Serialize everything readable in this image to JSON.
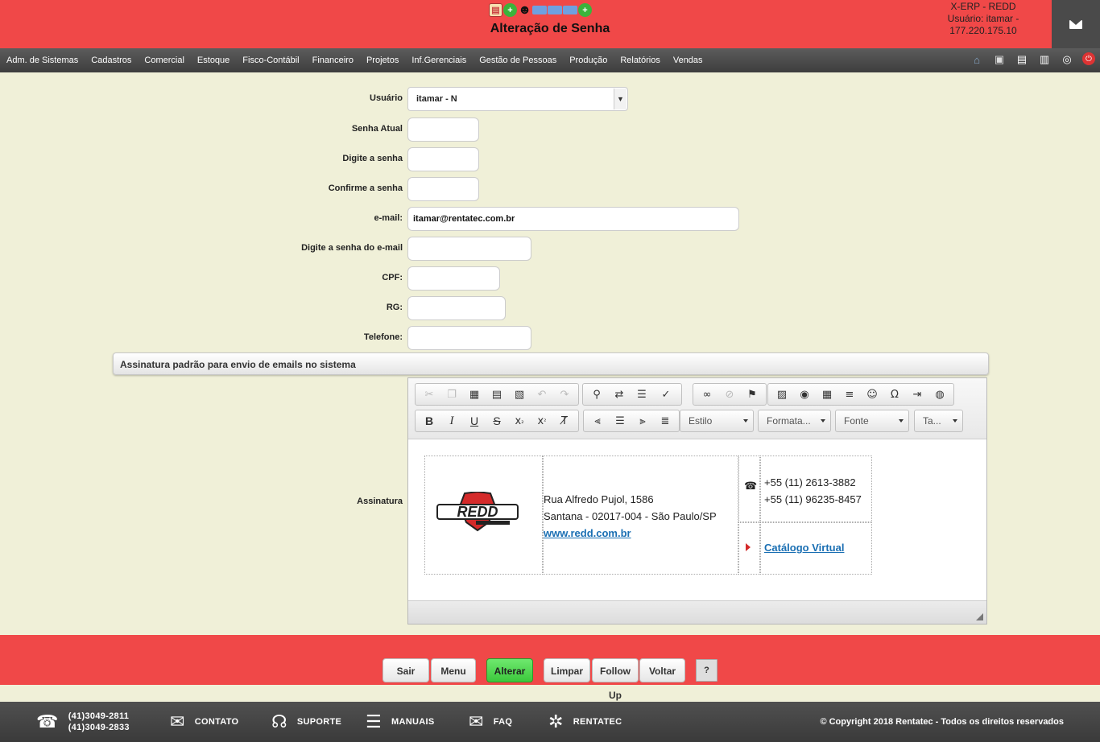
{
  "header": {
    "title": "Alteração de Senha",
    "system_line": "X-ERP - REDD",
    "user_line": "Usuário: itamar -",
    "ip_line": "177.220.175.10",
    "top_icons": [
      "document-icon",
      "add-icon",
      "users-icon",
      "keyboard-icon",
      "keyboard-icon",
      "keyboard-icon",
      "add-icon"
    ],
    "mail_icon": "envelope-icon"
  },
  "menu": {
    "items": [
      "Adm. de Sistemas",
      "Cadastros",
      "Comercial",
      "Estoque",
      "Fisco-Contábil",
      "Financeiro",
      "Projetos",
      "Inf.Gerenciais",
      "Gestão de Pessoas",
      "Produção",
      "Relatórios",
      "Vendas"
    ],
    "right_icons": [
      "home-icon",
      "print-icon",
      "document-icon",
      "page-icon",
      "help-icon",
      "power-icon"
    ]
  },
  "form": {
    "usuario": {
      "label": "Usuário",
      "value": "itamar - N"
    },
    "senha_atual": {
      "label": "Senha Atual",
      "value": ""
    },
    "digite_senha": {
      "label": "Digite a senha",
      "value": ""
    },
    "confirme_senha": {
      "label": "Confirme a senha",
      "value": ""
    },
    "email": {
      "label": "e-mail:",
      "value": "itamar@rentatec.com.br"
    },
    "senha_email": {
      "label": "Digite a senha do e-mail",
      "value": ""
    },
    "cpf": {
      "label": "CPF:",
      "value": ""
    },
    "rg": {
      "label": "RG:",
      "value": ""
    },
    "telefone": {
      "label": "Telefone:",
      "value": ""
    }
  },
  "signature_section": {
    "title": "Assinatura padrão para envio de emails no sistema",
    "label": "Assinatura"
  },
  "editor": {
    "dropdowns": {
      "style": "Estilo",
      "format": "Formata...",
      "font": "Fonte",
      "size": "Ta..."
    }
  },
  "signature": {
    "address1": "Rua Alfredo Pujol, 1586",
    "address2": "Santana - 02017-004 - São Paulo/SP",
    "website": "www.redd.com.br",
    "phone1": "+55 (11) 2613-3882",
    "phone2": "+55 (11) 96235-8457",
    "catalog": "Catálogo Virtual",
    "logo_text": "REDD"
  },
  "buttons": {
    "sair": "Sair",
    "menu": "Menu",
    "alterar": "Alterar",
    "limpar": "Limpar",
    "follow_up": "Follow Up",
    "voltar": "Voltar",
    "help": "?"
  },
  "footer": {
    "phone1": "(41)3049-2811",
    "phone2": "(41)3049-2833",
    "contato": "CONTATO",
    "suporte": "SUPORTE",
    "manuais": "MANUAIS",
    "faq": "FAQ",
    "rentatec": "RENTATEC",
    "copyright": "© Copyright 2018 Rentatec - Todos os direitos reservados"
  },
  "colors": {
    "header_red": "#f04848",
    "menu_dark": "#4a4a4a",
    "page_bg": "#f0f0d8",
    "accent_green": "#3cc83c",
    "link_blue": "#1a6fb3"
  }
}
